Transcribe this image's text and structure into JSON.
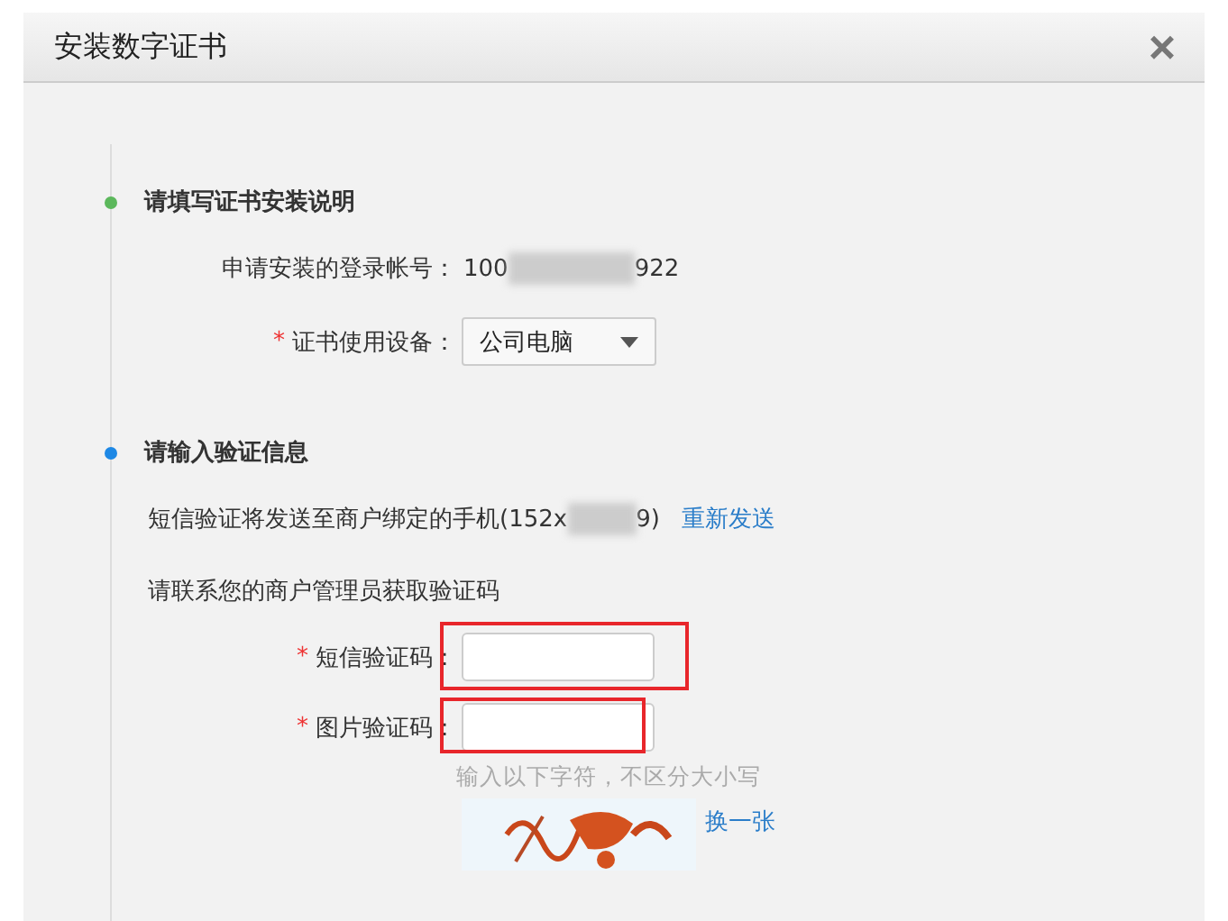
{
  "dialog": {
    "title": "安装数字证书",
    "close": "×"
  },
  "sections": [
    {
      "heading": "请填写证书安装说明",
      "color": "#5cb85c",
      "rows": [
        {
          "kind": "masked",
          "label": "申请安装的登录帐号：",
          "prefix": "100",
          "suffix": "922"
        },
        {
          "kind": "select",
          "label": "证书使用设备：",
          "mark": "*",
          "value": "公司电脑"
        }
      ]
    },
    {
      "heading": "请输入验证信息",
      "color": "#1e88e5",
      "rows": [
        {
          "kind": "masked_note",
          "prefix": "短信验证将发送至商户绑定的手机(152x",
          "suffix": "9)",
          "link": "重新发送"
        },
        {
          "kind": "note",
          "text": "请联系您的商户管理员获取验证码"
        },
        {
          "kind": "input",
          "label": "短信验证码：",
          "mark": "*",
          "highlighted": true
        },
        {
          "kind": "input",
          "label": "图片验证码：",
          "mark": "*",
          "highlighted": true
        },
        {
          "kind": "hint",
          "text": "输入以下字符，不区分大小写"
        },
        {
          "kind": "captcha",
          "link": "换一张"
        }
      ]
    }
  ]
}
